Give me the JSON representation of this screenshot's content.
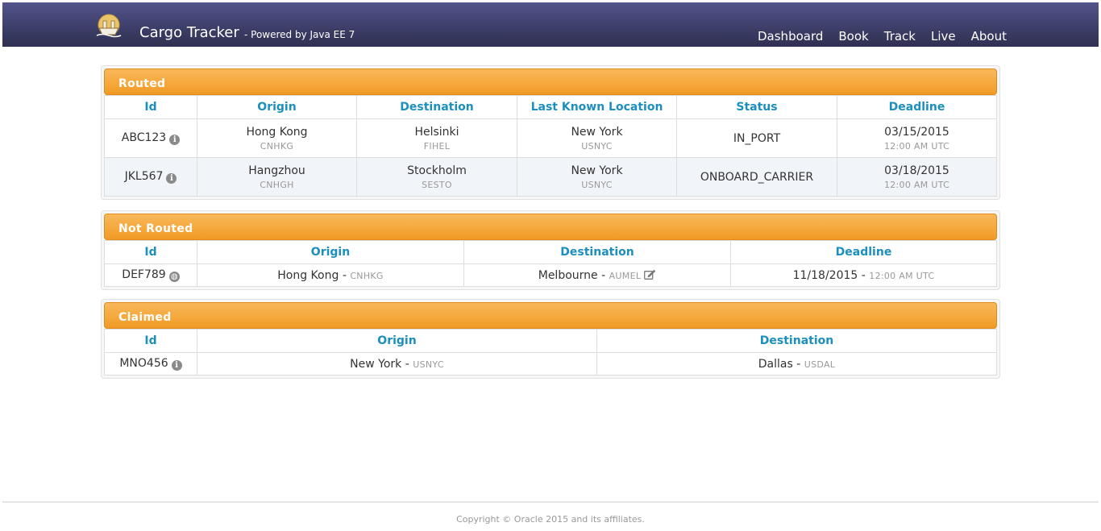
{
  "header": {
    "title": "Cargo Tracker",
    "subtitle": "- Powered by Java EE 7",
    "nav": [
      "Dashboard",
      "Book",
      "Track",
      "Live",
      "About"
    ]
  },
  "routed": {
    "title": "Routed",
    "columns": [
      "Id",
      "Origin",
      "Destination",
      "Last Known Location",
      "Status",
      "Deadline"
    ],
    "rows": [
      {
        "id": "ABC123",
        "origin": "Hong Kong",
        "origin_code": "CNHKG",
        "destination": "Helsinki",
        "destination_code": "FIHEL",
        "location": "New York",
        "location_code": "USNYC",
        "status": "IN_PORT",
        "deadline": "03/15/2015",
        "deadline_time": "12:00 AM UTC"
      },
      {
        "id": "JKL567",
        "origin": "Hangzhou",
        "origin_code": "CNHGH",
        "destination": "Stockholm",
        "destination_code": "SESTO",
        "location": "New York",
        "location_code": "USNYC",
        "status": "ONBOARD_CARRIER",
        "deadline": "03/18/2015",
        "deadline_time": "12:00 AM UTC"
      }
    ]
  },
  "not_routed": {
    "title": "Not Routed",
    "columns": [
      "Id",
      "Origin",
      "Destination",
      "Deadline"
    ],
    "rows": [
      {
        "id": "DEF789",
        "origin": "Hong Kong",
        "origin_code": "CNHKG",
        "destination": "Melbourne",
        "destination_code": "AUMEL",
        "deadline": "11/18/2015",
        "deadline_time": "12:00 AM UTC"
      }
    ]
  },
  "claimed": {
    "title": "Claimed",
    "columns": [
      "Id",
      "Origin",
      "Destination"
    ],
    "rows": [
      {
        "id": "MNO456",
        "origin": "New York",
        "origin_code": "USNYC",
        "destination": "Dallas",
        "destination_code": "USDAL"
      }
    ]
  },
  "separator": "-",
  "footer": {
    "text": "Copyright © Oracle 2015 and its affiliates."
  },
  "colors": {
    "header_bg": "#3e3f6a",
    "panel_head": "#f5a73a",
    "column_header": "#1b8fbe"
  },
  "icons": {
    "logo": "ship-logo-icon",
    "info": "info-icon",
    "route": "globe-icon",
    "edit": "edit-icon"
  }
}
